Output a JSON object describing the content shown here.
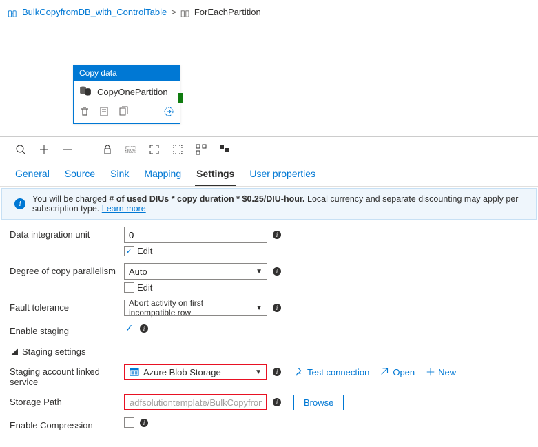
{
  "breadcrumb": {
    "root": "BulkCopyfromDB_with_ControlTable",
    "current": "ForEachPartition"
  },
  "node": {
    "header": "Copy data",
    "title": "CopyOnePartition"
  },
  "tabs": {
    "general": "General",
    "source": "Source",
    "sink": "Sink",
    "mapping": "Mapping",
    "settings": "Settings",
    "user_props": "User properties"
  },
  "info_bar": {
    "prefix": "You will be charged ",
    "bold": "# of used DIUs * copy duration * $0.25/DIU-hour.",
    "suffix": " Local currency and separate discounting may apply per subscription type. ",
    "link": "Learn more"
  },
  "form": {
    "diu_label": "Data integration unit",
    "diu_value": "0",
    "edit": "Edit",
    "parallel_label": "Degree of copy parallelism",
    "parallel_value": "Auto",
    "fault_label": "Fault tolerance",
    "fault_value": "Abort activity on first incompatible row",
    "staging_enable_label": "Enable staging",
    "staging_section": "Staging settings",
    "staging_linked_label": "Staging account linked service",
    "staging_linked_value": "Azure Blob Storage",
    "test_conn": "Test connection",
    "open": "Open",
    "new": "New",
    "path_label": "Storage Path",
    "path_value": "adfsolutiontemplate/BulkCopyfromDB_with_ControlTable",
    "browse": "Browse",
    "compress_label": "Enable Compression"
  }
}
